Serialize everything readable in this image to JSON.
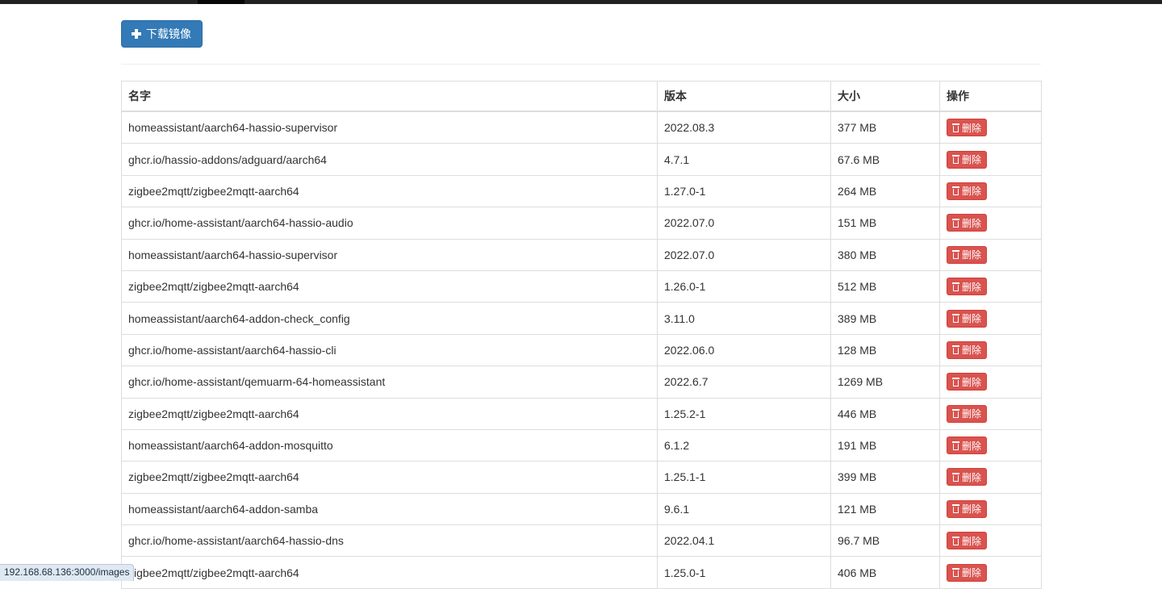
{
  "toolbar": {
    "download_label": "下载镜像"
  },
  "table": {
    "headers": {
      "name": "名字",
      "version": "版本",
      "size": "大小",
      "action": "操作"
    },
    "delete_label": "删除",
    "rows": [
      {
        "name": "homeassistant/aarch64-hassio-supervisor",
        "version": "2022.08.3",
        "size": "377 MB"
      },
      {
        "name": "ghcr.io/hassio-addons/adguard/aarch64",
        "version": "4.7.1",
        "size": "67.6 MB"
      },
      {
        "name": "zigbee2mqtt/zigbee2mqtt-aarch64",
        "version": "1.27.0-1",
        "size": "264 MB"
      },
      {
        "name": "ghcr.io/home-assistant/aarch64-hassio-audio",
        "version": "2022.07.0",
        "size": "151 MB"
      },
      {
        "name": "homeassistant/aarch64-hassio-supervisor",
        "version": "2022.07.0",
        "size": "380 MB"
      },
      {
        "name": "zigbee2mqtt/zigbee2mqtt-aarch64",
        "version": "1.26.0-1",
        "size": "512 MB"
      },
      {
        "name": "homeassistant/aarch64-addon-check_config",
        "version": "3.11.0",
        "size": "389 MB"
      },
      {
        "name": "ghcr.io/home-assistant/aarch64-hassio-cli",
        "version": "2022.06.0",
        "size": "128 MB"
      },
      {
        "name": "ghcr.io/home-assistant/qemuarm-64-homeassistant",
        "version": "2022.6.7",
        "size": "1269 MB"
      },
      {
        "name": "zigbee2mqtt/zigbee2mqtt-aarch64",
        "version": "1.25.2-1",
        "size": "446 MB"
      },
      {
        "name": "homeassistant/aarch64-addon-mosquitto",
        "version": "6.1.2",
        "size": "191 MB"
      },
      {
        "name": "zigbee2mqtt/zigbee2mqtt-aarch64",
        "version": "1.25.1-1",
        "size": "399 MB"
      },
      {
        "name": "homeassistant/aarch64-addon-samba",
        "version": "9.6.1",
        "size": "121 MB"
      },
      {
        "name": "ghcr.io/home-assistant/aarch64-hassio-dns",
        "version": "2022.04.1",
        "size": "96.7 MB"
      },
      {
        "name": "zigbee2mqtt/zigbee2mqtt-aarch64",
        "version": "1.25.0-1",
        "size": "406 MB"
      }
    ]
  },
  "status_bar": {
    "url": "192.168.68.136:3000/images"
  },
  "colors": {
    "primary": "#337ab7",
    "danger": "#d9534f"
  }
}
